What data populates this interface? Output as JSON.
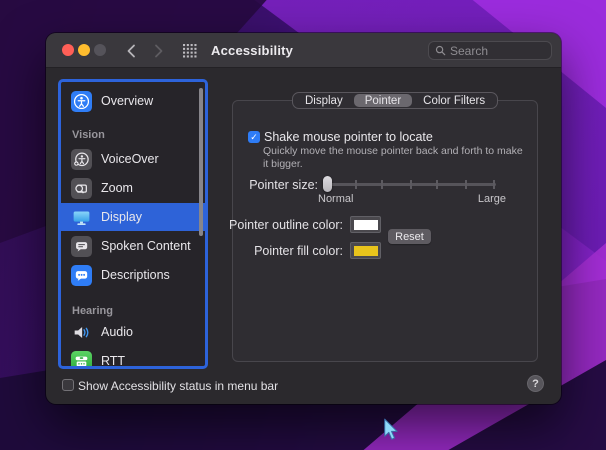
{
  "titlebar": {
    "title": "Accessibility",
    "search_placeholder": "Search",
    "traffic": {
      "red": "#ff5f57",
      "yellow": "#febc2e",
      "gray": "#55535a"
    }
  },
  "sidebar": {
    "headers": {
      "vision": "Vision",
      "hearing": "Hearing"
    },
    "items": [
      {
        "label": "Overview",
        "icon": "accessibility-overview-icon",
        "selected": false
      },
      {
        "label": "VoiceOver",
        "icon": "voiceover-icon",
        "selected": false
      },
      {
        "label": "Zoom",
        "icon": "zoom-icon",
        "selected": false
      },
      {
        "label": "Display",
        "icon": "display-icon",
        "selected": true
      },
      {
        "label": "Spoken Content",
        "icon": "spoken-content-icon",
        "selected": false
      },
      {
        "label": "Descriptions",
        "icon": "descriptions-icon",
        "selected": false
      },
      {
        "label": "Audio",
        "icon": "audio-icon",
        "selected": false
      },
      {
        "label": "RTT",
        "icon": "rtt-icon",
        "selected": false
      }
    ]
  },
  "tabs": [
    {
      "label": "Display",
      "selected": false
    },
    {
      "label": "Pointer",
      "selected": true
    },
    {
      "label": "Color Filters",
      "selected": false
    }
  ],
  "pointer_pane": {
    "shake": {
      "label": "Shake mouse pointer to locate",
      "checked": true,
      "description": [
        "Quickly move the mouse pointer back and forth to make",
        "it bigger."
      ]
    },
    "pointer_size": {
      "label": "Pointer size:",
      "min_label": "Normal",
      "max_label": "Large",
      "value": "Normal"
    },
    "outline_color": {
      "label": "Pointer outline color:",
      "value": "#ffffff"
    },
    "fill_color": {
      "label": "Pointer fill color:",
      "value": "#e9c41c"
    },
    "reset_label": "Reset"
  },
  "footer": {
    "checkbox_label": "Show Accessibility status in menu bar",
    "checked": false,
    "help_label": "?"
  },
  "colors": {
    "accent": "#2e7cf6",
    "selected_row": "#2e63d8",
    "focus_ring": "#2d63da"
  }
}
